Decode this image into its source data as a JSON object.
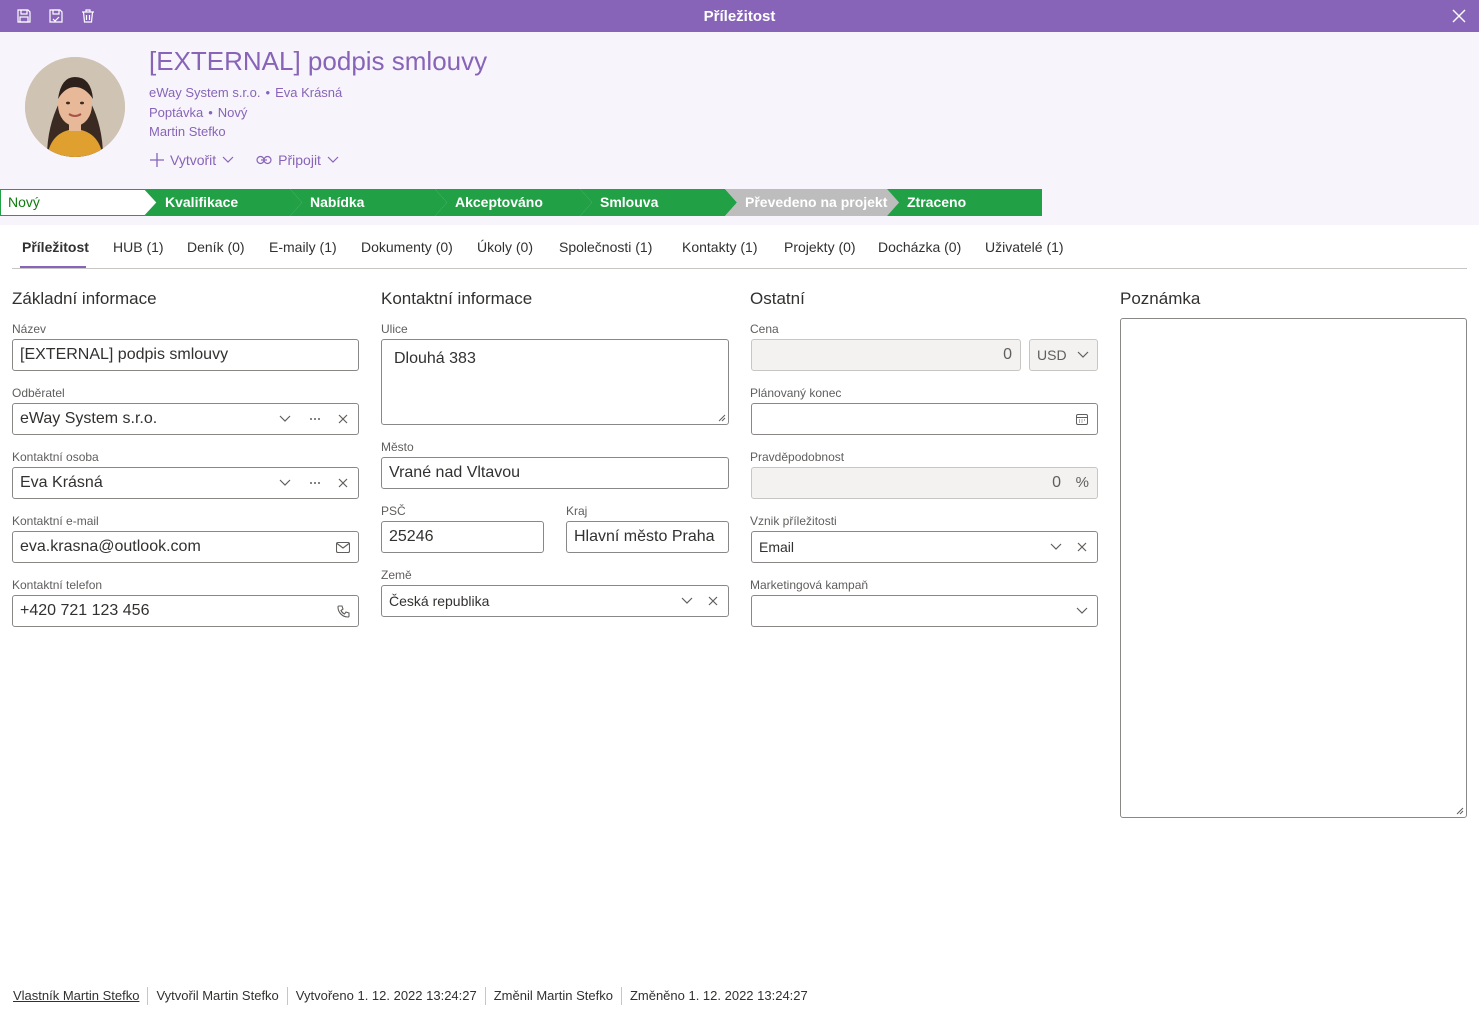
{
  "window": {
    "title": "Příležitost"
  },
  "toolbar_icons": [
    "save-icon",
    "save-and-close-icon",
    "delete-icon"
  ],
  "header": {
    "title": "[EXTERNAL] podpis smlouvy",
    "company": "eWay System s.r.o.",
    "contact": "Eva Krásná",
    "type": "Poptávka",
    "state": "Nový",
    "owner": "Martin Stefko",
    "create_label": "Vytvořit",
    "connect_label": "Připojit"
  },
  "stages": [
    {
      "label": "Nový",
      "status": "current",
      "color": "#ffffff",
      "text_color": "#107c10"
    },
    {
      "label": "Kvalifikace",
      "status": "todo",
      "color": "#22a046"
    },
    {
      "label": "Nabídka",
      "status": "todo",
      "color": "#22a046"
    },
    {
      "label": "Akceptováno",
      "status": "todo",
      "color": "#22a046"
    },
    {
      "label": "Smlouva",
      "status": "todo",
      "color": "#22a046"
    },
    {
      "label": "Převedeno na projekt",
      "status": "disabled",
      "color": "#bdbdbd"
    },
    {
      "label": "Ztraceno",
      "status": "todo",
      "color": "#22a046"
    }
  ],
  "tabs": [
    "Příležitost",
    "HUB (1)",
    "Deník (0)",
    "E-maily (1)",
    "Dokumenty (0)",
    "Úkoly (0)",
    "Společnosti (1)",
    "Kontakty (1)",
    "Projekty (0)",
    "Docházka (0)",
    "Uživatelé (1)"
  ],
  "basic": {
    "title": "Základní informace",
    "name_label": "Název",
    "name_value": "[EXTERNAL] podpis smlouvy",
    "customer_label": "Odběratel",
    "customer_value": "eWay System s.r.o.",
    "contact_label": "Kontaktní osoba",
    "contact_value": "Eva Krásná",
    "email_label": "Kontaktní e-mail",
    "email_value": "eva.krasna@outlook.com",
    "phone_label": "Kontaktní telefon",
    "phone_value": "+420 721 123 456"
  },
  "contact_info": {
    "title": "Kontaktní informace",
    "street_label": "Ulice",
    "street_value": "Dlouhá 383",
    "city_label": "Město",
    "city_value": "Vrané nad Vltavou",
    "zip_label": "PSČ",
    "zip_value": "25246",
    "region_label": "Kraj",
    "region_value": "Hlavní město Praha",
    "country_label": "Země",
    "country_value": "Česká republika"
  },
  "other": {
    "title": "Ostatní",
    "price_label": "Cena",
    "price_value": "0",
    "currency_value": "USD",
    "end_label": "Plánovaný konec",
    "end_value": "",
    "prob_label": "Pravděpodobnost",
    "prob_value": "0",
    "prob_unit": "%",
    "origin_label": "Vznik příležitosti",
    "origin_value": "Email",
    "campaign_label": "Marketingová kampaň",
    "campaign_value": ""
  },
  "note": {
    "title": "Poznámka",
    "value": ""
  },
  "footer": {
    "owner": "Vlastník Martin Stefko",
    "created_by": "Vytvořil Martin Stefko",
    "created": "Vytvořeno 1. 12. 2022 13:24:27",
    "changed_by": "Změnil Martin Stefko",
    "changed": "Změněno 1. 12. 2022 13:24:27"
  },
  "colors": {
    "accent": "#8764b8",
    "stage_green": "#22a046",
    "stage_gray": "#bdbdbd"
  }
}
